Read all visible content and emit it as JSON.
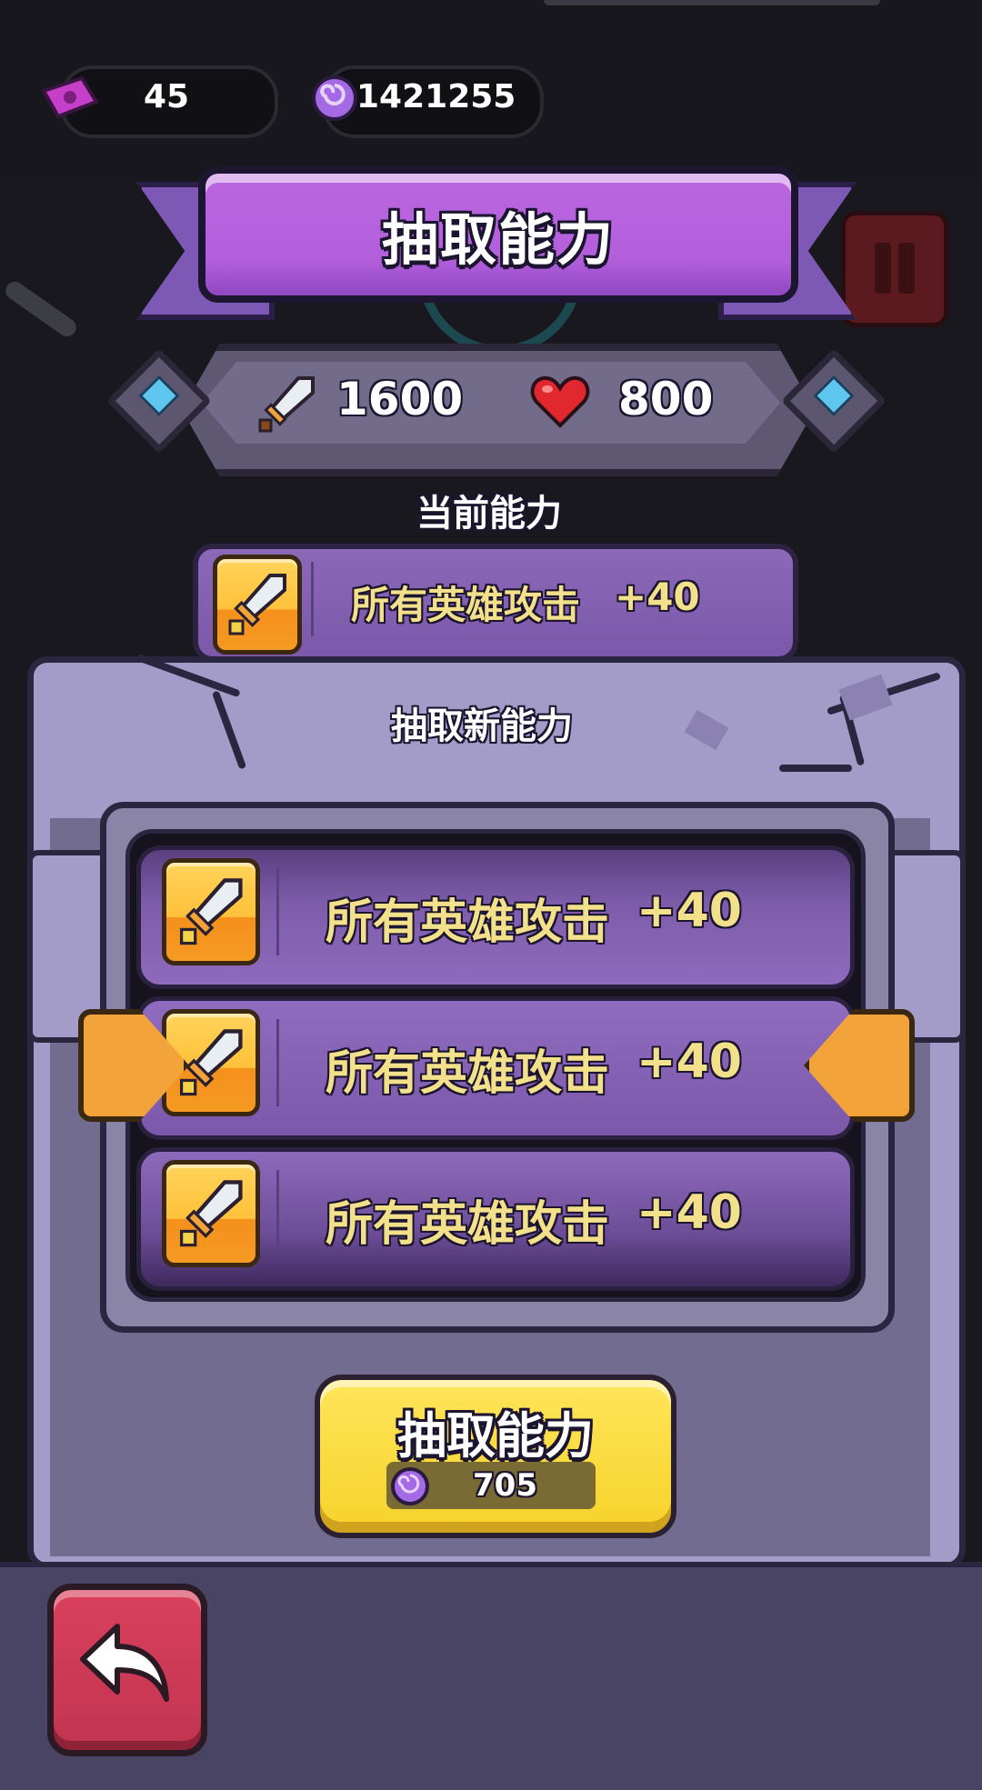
{
  "currencies": {
    "tickets": {
      "icon": "ticket-icon",
      "value": "45"
    },
    "orbs": {
      "icon": "purple-orb-icon",
      "value": "1421255"
    }
  },
  "title": "抽取能力",
  "stats": {
    "attack": {
      "icon": "sword-icon",
      "value": "1600"
    },
    "health": {
      "icon": "heart-icon",
      "value": "800"
    }
  },
  "current_ability": {
    "label": "当前能力",
    "icon": "sword-icon",
    "text": "所有英雄攻击",
    "bonus": "+40"
  },
  "new_ability": {
    "label": "抽取新能力",
    "options": [
      {
        "icon": "sword-icon",
        "text": "所有英雄攻击",
        "bonus": "+40"
      },
      {
        "icon": "sword-icon",
        "text": "所有英雄攻击",
        "bonus": "+40"
      },
      {
        "icon": "sword-icon",
        "text": "所有英雄攻击",
        "bonus": "+40"
      }
    ]
  },
  "draw_button": {
    "label": "抽取能力",
    "cost_icon": "purple-orb-icon",
    "cost": "705"
  },
  "back_button": {
    "icon": "back-arrow-icon"
  },
  "colors": {
    "title_purple": "#b35fdc",
    "card_purple": "#8a66b8",
    "icon_gold": "#ffc13a",
    "ability_text": "#f3e08a",
    "button_yellow": "#f6d22a",
    "back_red": "#c23450",
    "stone": "#a49cc8"
  }
}
